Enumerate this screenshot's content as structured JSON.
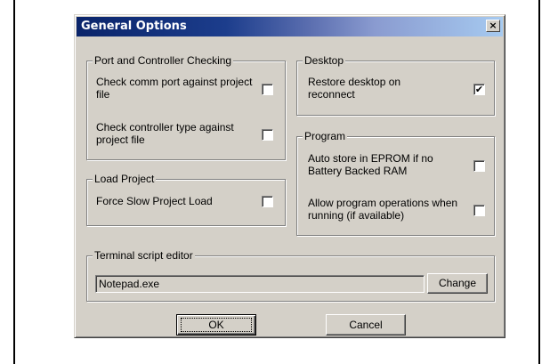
{
  "window": {
    "title": "General Options",
    "close_glyph": "×"
  },
  "groups": {
    "port": {
      "label": "Port and Controller Checking",
      "options": [
        {
          "label": "Check comm port against project file",
          "checked": false
        },
        {
          "label": "Check controller type against project file",
          "checked": false
        }
      ]
    },
    "load": {
      "label": "Load Project",
      "options": [
        {
          "label": "Force Slow Project Load",
          "checked": false
        }
      ]
    },
    "desktop": {
      "label": "Desktop",
      "options": [
        {
          "label": "Restore desktop on reconnect",
          "checked": true
        }
      ]
    },
    "program": {
      "label": "Program",
      "options": [
        {
          "label": "Auto store in EPROM if no Battery Backed RAM",
          "checked": false
        },
        {
          "label": "Allow program operations when running (if available)",
          "checked": false
        }
      ]
    },
    "terminal": {
      "label": "Terminal script editor",
      "value": "Notepad.exe",
      "change_label": "Change"
    }
  },
  "buttons": {
    "ok": "OK",
    "cancel": "Cancel"
  },
  "check_glyph": "✔",
  "colors": {
    "titlebar_start": "#0a246a",
    "titlebar_end": "#a6caf0",
    "dialog_bg": "#d4d0c8"
  },
  "icons": {
    "close": "close-icon",
    "check": "checkmark-icon"
  }
}
